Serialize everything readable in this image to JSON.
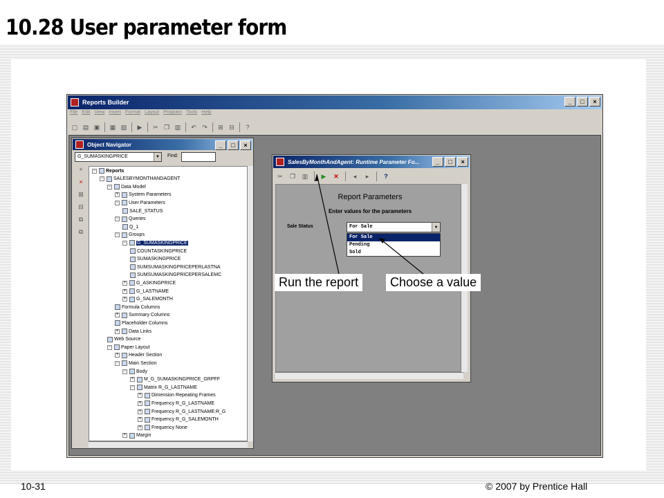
{
  "slide": {
    "title": "10.28 User parameter form",
    "footer_left": "10-31",
    "footer_right": "© 2007 by Prentice Hall"
  },
  "app": {
    "title": "Reports Builder",
    "menu": [
      "File",
      "Edit",
      "View",
      "Insert",
      "Format",
      "Layout",
      "Program",
      "Tools",
      "Help"
    ]
  },
  "navigator": {
    "title": "Object Navigator",
    "combo_value": "G_SUMASKINGPRICE",
    "find_label": "Find:",
    "tree": [
      {
        "label": "Reports",
        "level": 0,
        "exp": "−",
        "bold": true
      },
      {
        "label": "SALESBYMONTHANDAGENT",
        "level": 1,
        "exp": "−"
      },
      {
        "label": "Data Model",
        "level": 2,
        "exp": "−"
      },
      {
        "label": "System Parameters",
        "level": 3,
        "exp": "+"
      },
      {
        "label": "User Parameters",
        "level": 3,
        "exp": "−"
      },
      {
        "label": "SALE_STATUS",
        "level": 4,
        "exp": ""
      },
      {
        "label": "Queries",
        "level": 3,
        "exp": "−"
      },
      {
        "label": "Q_1",
        "level": 4,
        "exp": ""
      },
      {
        "label": "Groups",
        "level": 3,
        "exp": "−"
      },
      {
        "label": "G_SUMASKINGPRICE",
        "level": 4,
        "exp": "−",
        "selected": true
      },
      {
        "label": "COUNTASKINGPRICE",
        "level": 5,
        "exp": ""
      },
      {
        "label": "SUMASKINGPRICE",
        "level": 5,
        "exp": ""
      },
      {
        "label": "SUMSUMASKINGPRICEPERLASTNA",
        "level": 5,
        "exp": ""
      },
      {
        "label": "SUMSUMASKINGPRICEPERSALEMC",
        "level": 5,
        "exp": ""
      },
      {
        "label": "G_ASKINGPRICE",
        "level": 4,
        "exp": "+"
      },
      {
        "label": "G_LASTNAME",
        "level": 4,
        "exp": "+"
      },
      {
        "label": "G_SALEMONTH",
        "level": 4,
        "exp": "+"
      },
      {
        "label": "Formula Columns",
        "level": 3,
        "exp": ""
      },
      {
        "label": "Summary Columns",
        "level": 3,
        "exp": "+"
      },
      {
        "label": "Placeholder Columns",
        "level": 3,
        "exp": ""
      },
      {
        "label": "Data Links",
        "level": 3,
        "exp": "+"
      },
      {
        "label": "Web Source",
        "level": 2,
        "exp": ""
      },
      {
        "label": "Paper Layout",
        "level": 2,
        "exp": "−"
      },
      {
        "label": "Header Section",
        "level": 3,
        "exp": "+"
      },
      {
        "label": "Main Section",
        "level": 3,
        "exp": "−"
      },
      {
        "label": "Body",
        "level": 4,
        "exp": "−"
      },
      {
        "label": "M_G_SUMASKINGPRICE_GRPFF",
        "level": 5,
        "exp": "+"
      },
      {
        "label": "Matrix R_G_LASTNAME",
        "level": 5,
        "exp": "−"
      },
      {
        "label": "Dimension Repeating Frames",
        "level": 6,
        "exp": "+"
      },
      {
        "label": "Frequency R_G_LASTNAME",
        "level": 6,
        "exp": "+"
      },
      {
        "label": "Frequency R_G_LASTNAME:R_G",
        "level": 6,
        "exp": "+"
      },
      {
        "label": "Frequency R_G_SALEMONTH",
        "level": 6,
        "exp": "+"
      },
      {
        "label": "Frequency None",
        "level": 6,
        "exp": "+"
      },
      {
        "label": "Margin",
        "level": 4,
        "exp": "+"
      }
    ]
  },
  "param_window": {
    "title": "SalesByMonthAndAgent: Runtime Parameter Fo...",
    "heading": "Report Parameters",
    "subheading": "Enter values for the parameters",
    "field_label": "Sale Status",
    "selected_value": "For Sale",
    "options": [
      "For Sale",
      "Pending",
      "Sold"
    ]
  },
  "callouts": {
    "run": "Run the report",
    "choose": "Choose a value"
  }
}
